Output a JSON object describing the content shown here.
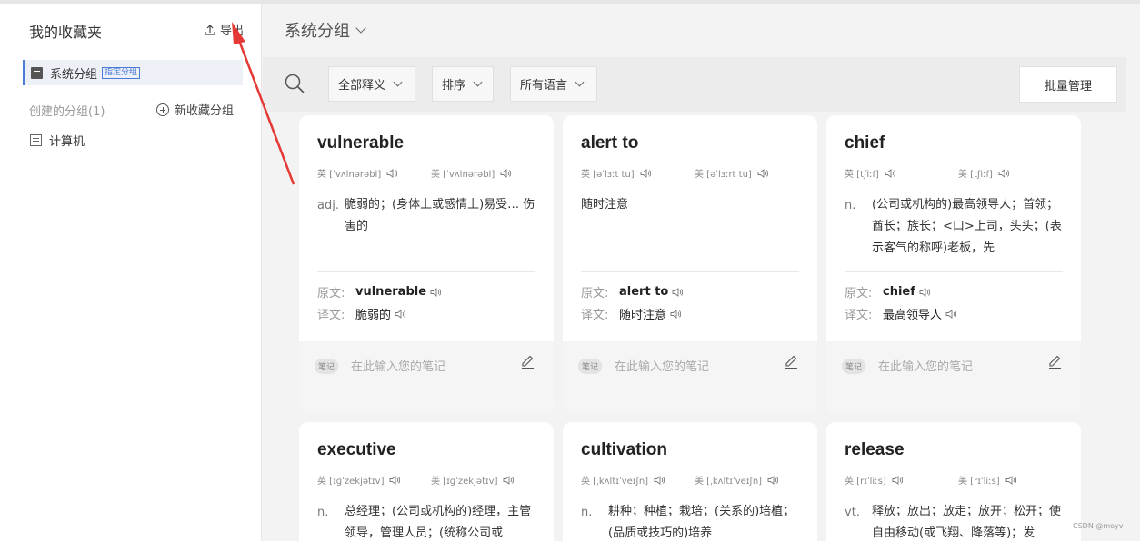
{
  "sidebar": {
    "title": "我的收藏夹",
    "export_label": "导出",
    "system_group": {
      "label": "系统分组",
      "tag": "指定分组"
    },
    "created_label": "创建的分组(1)",
    "new_group_label": "新收藏分组",
    "groups": [
      {
        "label": "计算机"
      }
    ]
  },
  "main": {
    "title": "系统分组",
    "filters": [
      {
        "label": "全部释义"
      },
      {
        "label": "排序"
      },
      {
        "label": "所有语言"
      }
    ],
    "batch_label": "批量管理"
  },
  "cards": [
    {
      "word": "vulnerable",
      "uk": "英 [ˈvʌlnərəbl]",
      "us": "美 [ˈvʌlnərəbl]",
      "pos": "adj.",
      "definition": "脆弱的；(身体上或感情上)易受… 伤害的",
      "orig_label": "原文:",
      "orig": "vulnerable",
      "trans_label": "译文:",
      "trans": "脆弱的",
      "note_tag": "笔记",
      "note_placeholder": "在此输入您的笔记"
    },
    {
      "word": "alert to",
      "uk": "英 [əˈlɜːt tu]",
      "us": "美 [əˈlɜːrt tu]",
      "pos": "",
      "definition": "随时注意",
      "orig_label": "原文:",
      "orig": "alert to",
      "trans_label": "译文:",
      "trans": "随时注意",
      "note_tag": "笔记",
      "note_placeholder": "在此输入您的笔记"
    },
    {
      "word": "chief",
      "uk": "英 [tʃiːf]",
      "us": "美 [tʃiːf]",
      "pos": "n.",
      "definition": "(公司或机构的)最高领导人；首领；酋长；族长；<口>上司，头头；(表示客气的称呼)老板，先",
      "orig_label": "原文:",
      "orig": "chief",
      "trans_label": "译文:",
      "trans": "最高领导人",
      "note_tag": "笔记",
      "note_placeholder": "在此输入您的笔记"
    },
    {
      "word": "executive",
      "uk": "英 [ɪɡˈzekjətɪv]",
      "us": "美 [ɪɡˈzekjətɪv]",
      "pos": "n.",
      "definition": "总经理；(公司或机构的)经理，主管领导，管理人员；(统称公司或"
    },
    {
      "word": "cultivation",
      "uk": "英 [ˌkʌltɪˈveɪʃn]",
      "us": "美 [ˌkʌltɪˈveɪʃn]",
      "pos": "n.",
      "definition": "耕种；种植；栽培；(关系的)培植；(品质或技巧的)培养"
    },
    {
      "word": "release",
      "uk": "英 [rɪˈliːs]",
      "us": "美 [rɪˈliːs]",
      "pos": "vt.",
      "definition": "释放；放出；放走；放开；松开；使自由移动(或飞翔、降落等)；发"
    }
  ],
  "watermark": "CSDN @moyv"
}
